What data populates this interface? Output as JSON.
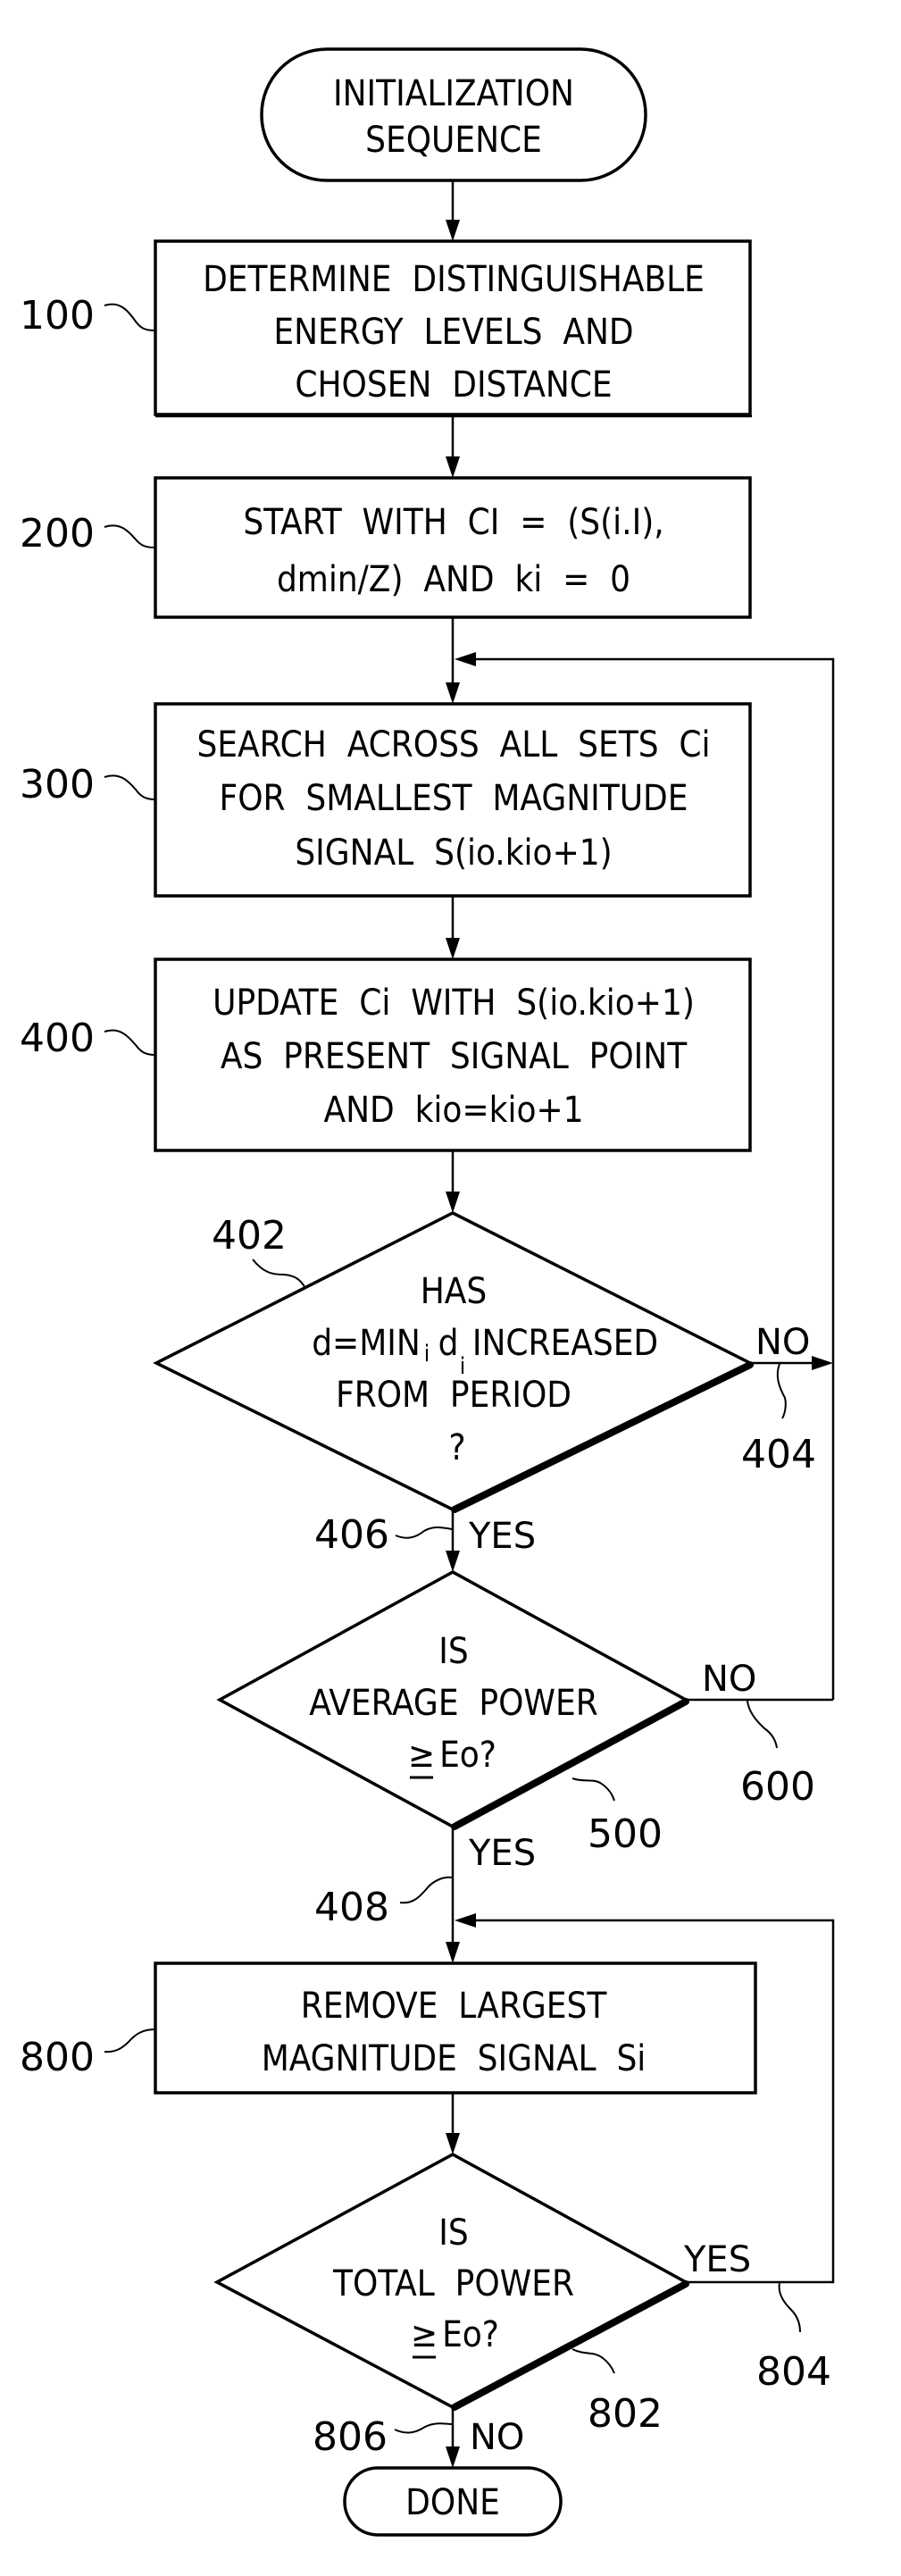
{
  "figure": {
    "kind": "patent flowchart",
    "start": {
      "lines": [
        "INITIALIZATION",
        "SEQUENCE"
      ]
    },
    "end": {
      "lines": [
        "DONE"
      ]
    },
    "steps": [
      {
        "ref": "100",
        "type": "process",
        "lines": [
          "DETERMINE  DISTINGUISHABLE",
          "ENERGY  LEVELS  AND",
          "CHOSEN  DISTANCE"
        ]
      },
      {
        "ref": "200",
        "type": "process",
        "lines": [
          "START  WITH  CI  =  (S(i.I),",
          "dmin/Z)  AND  ki  =  0"
        ]
      },
      {
        "ref": "300",
        "type": "process",
        "lines": [
          "SEARCH  ACROSS  ALL  SETS  Ci",
          "FOR  SMALLEST  MAGNITUDE",
          "SIGNAL  S(io.kio+1)"
        ]
      },
      {
        "ref": "400",
        "type": "process",
        "lines": [
          "UPDATE  Ci  WITH  S(io.kio+1)",
          "AS  PRESENT  SIGNAL  POINT",
          "AND  kio=kio+1"
        ]
      },
      {
        "ref": "402",
        "type": "decision",
        "lines": [
          "HAS",
          "d=MIN",
          "INCREASED",
          "FROM  PERIOD",
          "?"
        ],
        "sub_min": "i",
        "sub_d": "d",
        "sub_i": "i"
      },
      {
        "ref": "500",
        "type": "decision",
        "lines": [
          "IS",
          "AVERAGE  POWER",
          "Eo?"
        ],
        "ge": "≥"
      },
      {
        "ref": "800",
        "type": "process",
        "lines": [
          "REMOVE  LARGEST",
          "MAGNITUDE  SIGNAL  Si"
        ]
      },
      {
        "ref": "802",
        "type": "decision",
        "lines": [
          "IS",
          "TOTAL  POWER",
          "Eo?"
        ],
        "ge": "≥"
      }
    ],
    "branches": {
      "b404": {
        "ref": "404",
        "label": "NO"
      },
      "b406": {
        "ref": "406",
        "label": "YES"
      },
      "b600": {
        "ref": "600",
        "label": "NO"
      },
      "b408": {
        "ref": "408",
        "label": "YES"
      },
      "b804": {
        "ref": "804",
        "label": "YES"
      },
      "b806": {
        "ref": "806",
        "label": "NO"
      }
    }
  }
}
